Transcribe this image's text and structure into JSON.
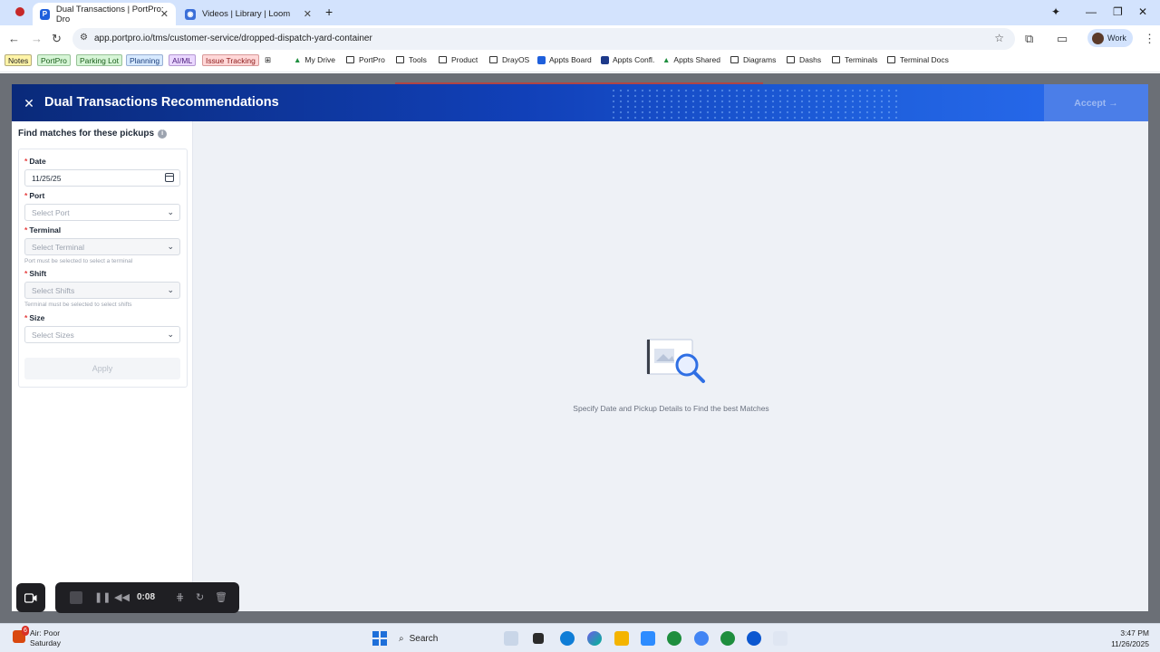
{
  "browser": {
    "tabs": [
      {
        "title": "Dual Transactions | PortPro: Dro",
        "active": true
      },
      {
        "title": "Videos | Library | Loom",
        "active": false
      }
    ],
    "url": "app.portpro.io/tms/customer-service/dropped-dispatch-yard-container",
    "profile_label": "Work"
  },
  "bookmarks": {
    "chips": [
      {
        "label": "Notes",
        "bg": "#fff4a8",
        "fg": "#1f1f1f"
      },
      {
        "label": "PortPro",
        "bg": "#d6f5d6",
        "fg": "#1a5d1a"
      },
      {
        "label": "Parking Lot",
        "bg": "#d6f5d6",
        "fg": "#1a5d1a"
      },
      {
        "label": "Planning",
        "bg": "#d7e9ff",
        "fg": "#1a3d7a"
      },
      {
        "label": "AI/ML",
        "bg": "#ead7ff",
        "fg": "#4b1a7a"
      },
      {
        "label": "Issue Tracking",
        "bg": "#ffd7d7",
        "fg": "#8a1a1a"
      }
    ],
    "items": [
      "My Drive",
      "PortPro",
      "Tools",
      "Product",
      "DrayOS",
      "Appts Board",
      "Appts Confl.",
      "Appts Shared",
      "Diagrams",
      "Dashs",
      "Terminals",
      "Terminal Docs"
    ]
  },
  "modal": {
    "title": "Dual Transactions Recommendations",
    "accept_label": "Accept →",
    "find_title": "Find matches for these pickups",
    "form": {
      "date_label": "Date",
      "date_value": "11/25/25",
      "port_label": "Port",
      "port_placeholder": "Select Port",
      "terminal_label": "Terminal",
      "terminal_placeholder": "Select Terminal",
      "terminal_hint": "Port must be selected to select a terminal",
      "shift_label": "Shift",
      "shift_placeholder": "Select Shifts",
      "shift_hint": "Terminal must be selected to select shifts",
      "size_label": "Size",
      "size_placeholder": "Select Sizes",
      "apply_label": "Apply"
    },
    "empty_state": "Specify Date and Pickup Details to Find the best Matches"
  },
  "recorder": {
    "time": "0:08"
  },
  "taskbar": {
    "weather_title": "Air: Poor",
    "weather_sub": "Saturday",
    "weather_badge": "6",
    "search_label": "Search",
    "time": "3:47 PM",
    "date": "11/26/2025"
  },
  "colors": {
    "accent": "#1e5fdc",
    "header_dark": "#0a2a7a",
    "required": "#e53e3e"
  }
}
